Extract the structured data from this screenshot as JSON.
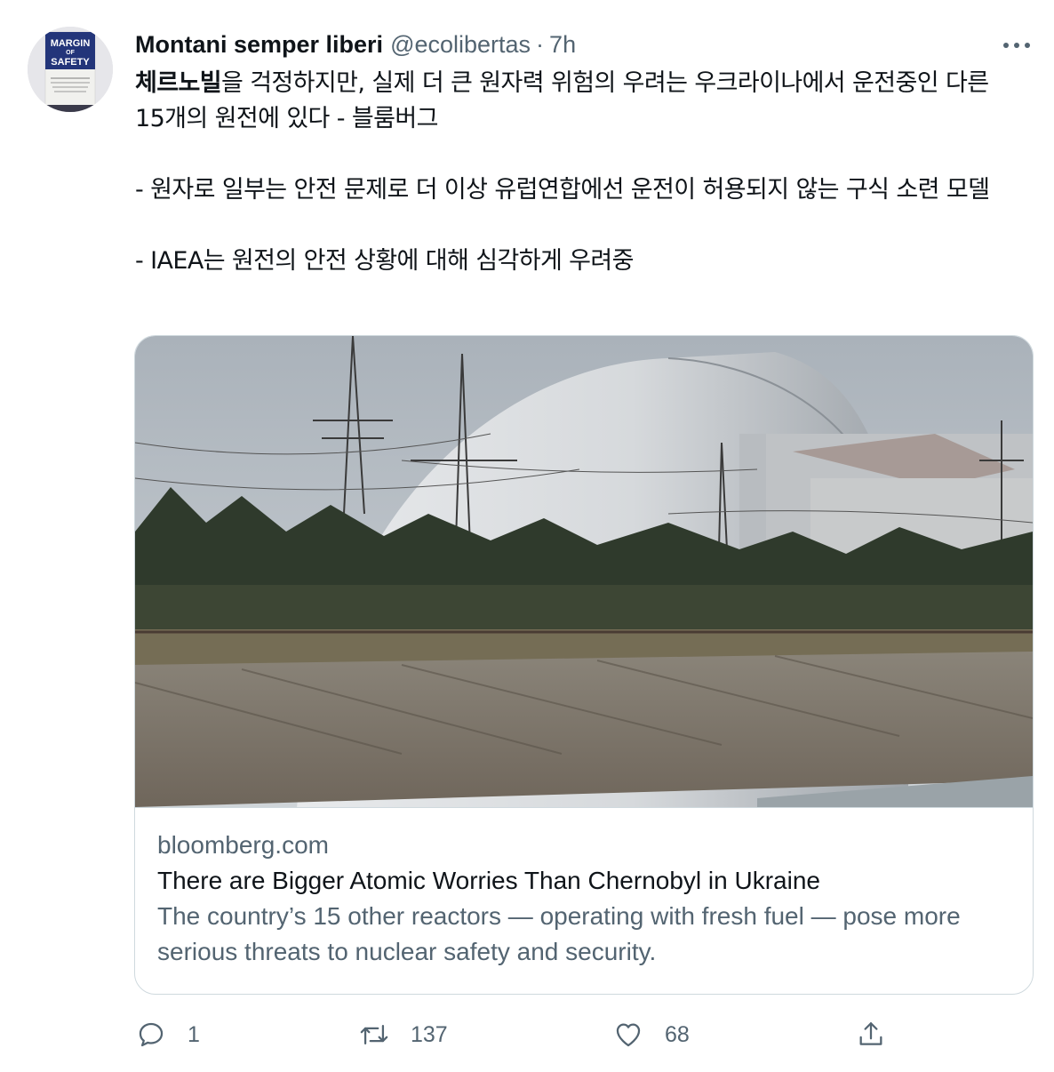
{
  "tweet": {
    "author_name": "Montani semper liberi",
    "handle": "@ecolibertas",
    "separator": "·",
    "time": "7h",
    "avatar_text": {
      "line1": "MARGIN",
      "line2": "OF",
      "line3": "SAFETY",
      "subtitle": "Risk-Averse Value Investing Strategies for the Thoughtful Investor"
    },
    "text": {
      "bold_lead": "체르노빌",
      "line1_rest": "을 걱정하지만, 실제 더 큰 원자력 위험의 우려는 우크라이나에서 운전중인 다른 15개의 원전에 있다 - 블룸버그",
      "line2": "- 원자로 일부는 안전 문제로 더 이상 유럽연합에선 운전이 허용되지 않는 구식 소련 모델",
      "line3": "- IAEA는 원전의 안전 상황에 대해 심각하게 우려중"
    },
    "card": {
      "domain": "bloomberg.com",
      "title": "There are Bigger Atomic Worries Than Chernobyl in Ukraine",
      "description": "The country’s 15 other reactors — operating with fresh fuel — pose more serious threats to nuclear safety and security.",
      "image": "chernobyl-arch-photo"
    },
    "actions": {
      "reply_count": "1",
      "retweet_count": "137",
      "like_count": "68"
    }
  },
  "icons": [
    "more-icon",
    "reply-icon",
    "retweet-icon",
    "like-icon",
    "share-icon"
  ],
  "colors": {
    "text": "#0f1419",
    "secondary": "#536471",
    "border": "#cfd9de"
  }
}
